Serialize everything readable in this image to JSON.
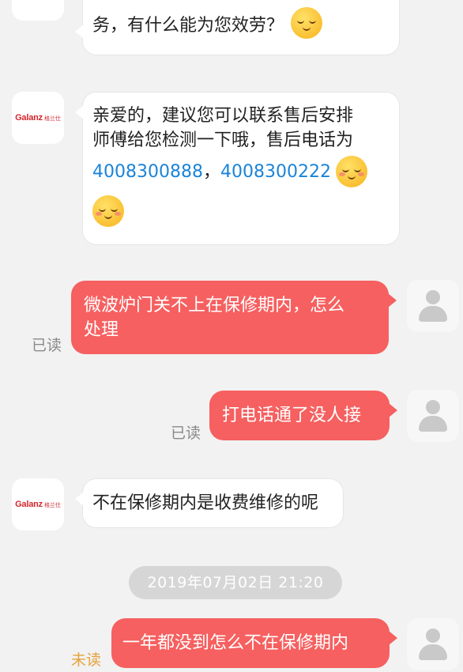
{
  "messages": {
    "m1": {
      "line": "务，有什么能为您效劳？",
      "emoji": "thinking-face-emoji"
    },
    "m2": {
      "line1": "亲爱的，建议您可以联系售后安排",
      "line2": "师傅给您检测一下哦，售后电话为",
      "phone1": "4008300888",
      "separator": "，",
      "phone2": "4008300222",
      "emoji": "smiling-face-emoji"
    },
    "m3": {
      "line1": "微波炉门关不上在保修期内，怎么",
      "line2": "处理",
      "status": "已读"
    },
    "m4": {
      "text": "打电话通了没人接",
      "status": "已读"
    },
    "m5": {
      "text": "不在保修期内是收费维修的呢"
    },
    "timestamp": "2019年07月02日  21:20",
    "m6": {
      "text": "一年都没到怎么不在保修期内",
      "status": "未读"
    }
  },
  "brand": {
    "logo_text": "Galanz",
    "logo_cn": "格兰仕",
    "color": "#d3262d"
  },
  "colors": {
    "outgoing": "#f66060",
    "incoming": "#ffffff",
    "link": "#1a84d8",
    "unread": "#e6a23c"
  }
}
